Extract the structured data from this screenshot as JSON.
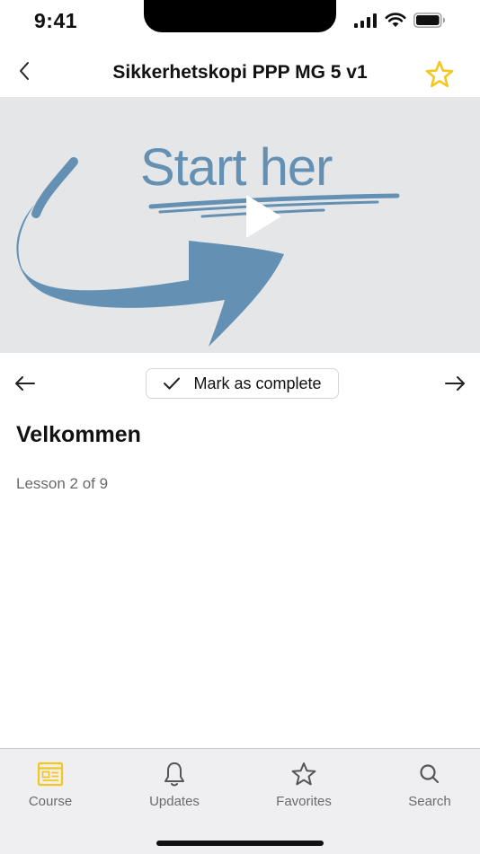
{
  "status_bar": {
    "time": "9:41"
  },
  "header": {
    "title": "Sikkerhetskopi PPP MG 5 v1",
    "favorite_icon": "star-outline-icon",
    "back_icon": "chevron-left-icon"
  },
  "video": {
    "thumbnail_text": "Start her",
    "play_icon": "play-icon"
  },
  "controls": {
    "mark_complete_label": "Mark as complete",
    "check_icon": "checkmark-icon",
    "prev_icon": "arrow-left-icon",
    "next_icon": "arrow-right-icon"
  },
  "lesson": {
    "title": "Velkommen",
    "progress": "Lesson 2 of 9"
  },
  "tabs": [
    {
      "label": "Course",
      "icon": "course-icon",
      "active": true
    },
    {
      "label": "Updates",
      "icon": "bell-icon",
      "active": false
    },
    {
      "label": "Favorites",
      "icon": "star-icon",
      "active": false
    },
    {
      "label": "Search",
      "icon": "search-icon",
      "active": false
    }
  ],
  "colors": {
    "accent": "#f2c81e",
    "video_bg": "#e5e6e8",
    "brush_blue": "#6491b3",
    "tab_bg": "#efeff1"
  }
}
